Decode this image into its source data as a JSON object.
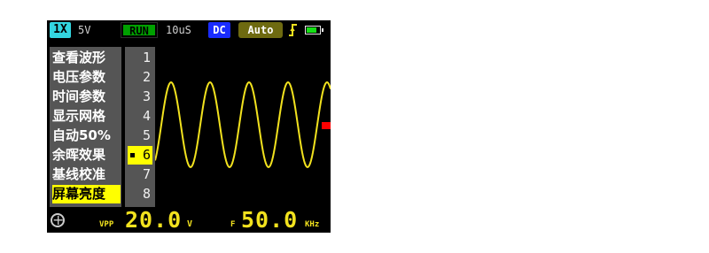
{
  "status_bar": {
    "probe": "1X",
    "volts_per_div": "5V",
    "run_state": "RUN",
    "time_per_div": "10uS",
    "coupling": "DC",
    "trigger_mode": "Auto",
    "trigger_edge_icon": "rising-edge-icon",
    "battery_icon": "battery-icon",
    "battery_level": 0.75
  },
  "menu": {
    "items": [
      {
        "label": "查看波形"
      },
      {
        "label": "电压参数"
      },
      {
        "label": "时间参数"
      },
      {
        "label": "显示网格"
      },
      {
        "label": "自动50%"
      },
      {
        "label": "余晖效果"
      },
      {
        "label": "基线校准"
      },
      {
        "label": "屏幕亮度"
      }
    ],
    "selected_index": 7
  },
  "value_column": {
    "options": [
      "1",
      "2",
      "3",
      "4",
      "5",
      "6",
      "7",
      "8"
    ],
    "selected_index": 5
  },
  "measurements": {
    "vpp_label": "VPP",
    "vpp_value": "20.0",
    "vpp_unit": "V",
    "freq_label": "F",
    "freq_value": "50.0",
    "freq_unit": "KHz"
  },
  "colors": {
    "trace": "#f2e21e",
    "highlight": "#ffff00",
    "trigger_level_marker": "#ff0000"
  }
}
